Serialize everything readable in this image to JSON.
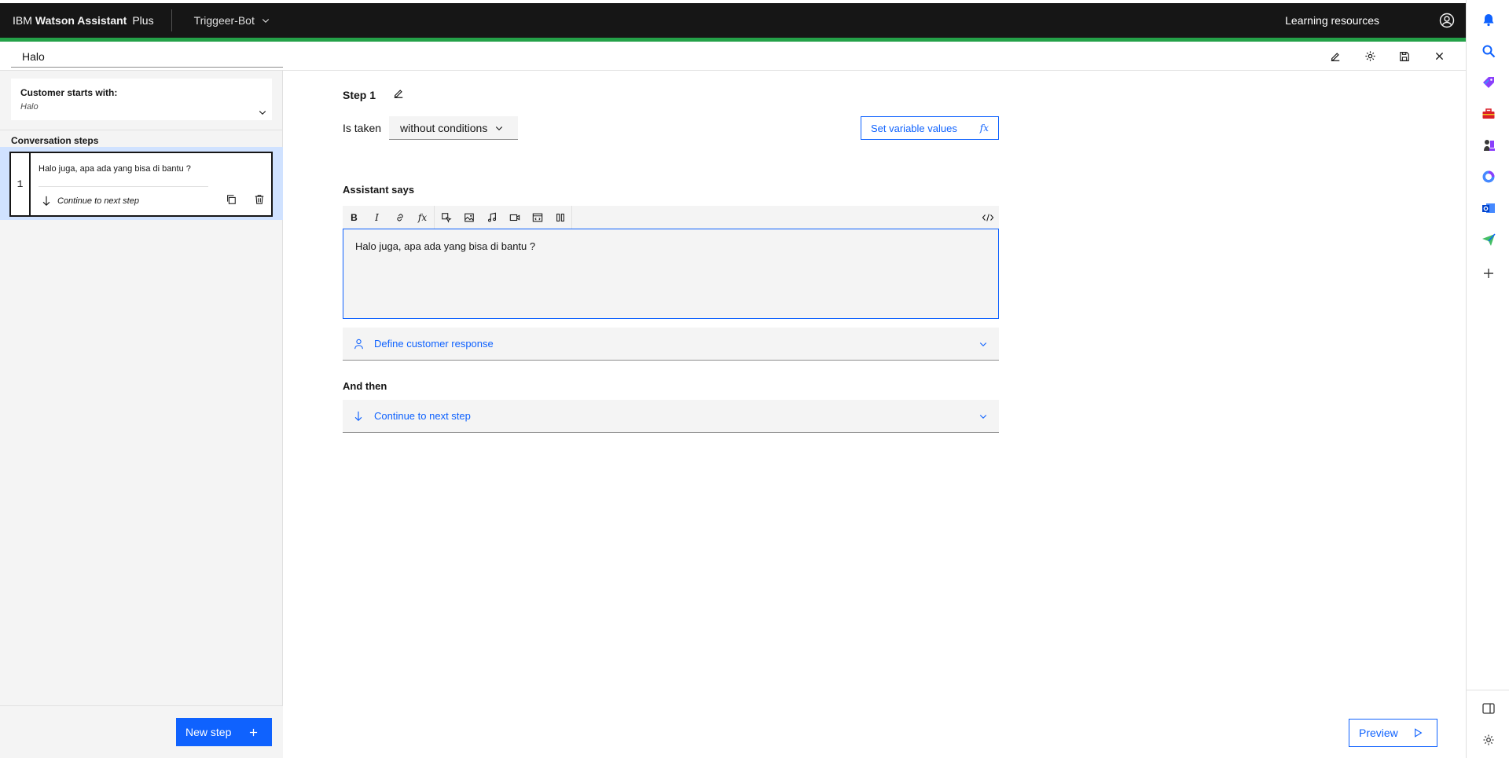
{
  "header": {
    "brand_prefix": "IBM",
    "brand_name": "Watson Assistant",
    "plan": "Plus",
    "assistant_name": "Triggeer-Bot",
    "learning_resources": "Learning resources"
  },
  "action": {
    "title": "Halo"
  },
  "sidebar": {
    "customer_starts_label": "Customer starts with:",
    "customer_starts_value": "Halo",
    "conversation_steps_label": "Conversation steps",
    "steps": [
      {
        "number": "1",
        "text": "Halo juga, apa ada yang bisa di bantu ?",
        "next": "Continue to next step"
      }
    ],
    "new_step_label": "New step"
  },
  "step": {
    "title": "Step 1",
    "is_taken_label": "Is taken",
    "condition_value": "without conditions",
    "set_variable_label": "Set variable values",
    "assistant_says_label": "Assistant says",
    "assistant_says_text": "Halo juga, apa ada yang bisa di bantu ?",
    "define_customer_response": "Define customer response",
    "and_then_label": "And then",
    "and_then_value": "Continue to next step"
  },
  "preview_label": "Preview",
  "colors": {
    "primary": "#0f62fe",
    "header_bg": "#161616",
    "header_accent": "#24a148",
    "selected_step_bg": "#d0e2ff"
  }
}
